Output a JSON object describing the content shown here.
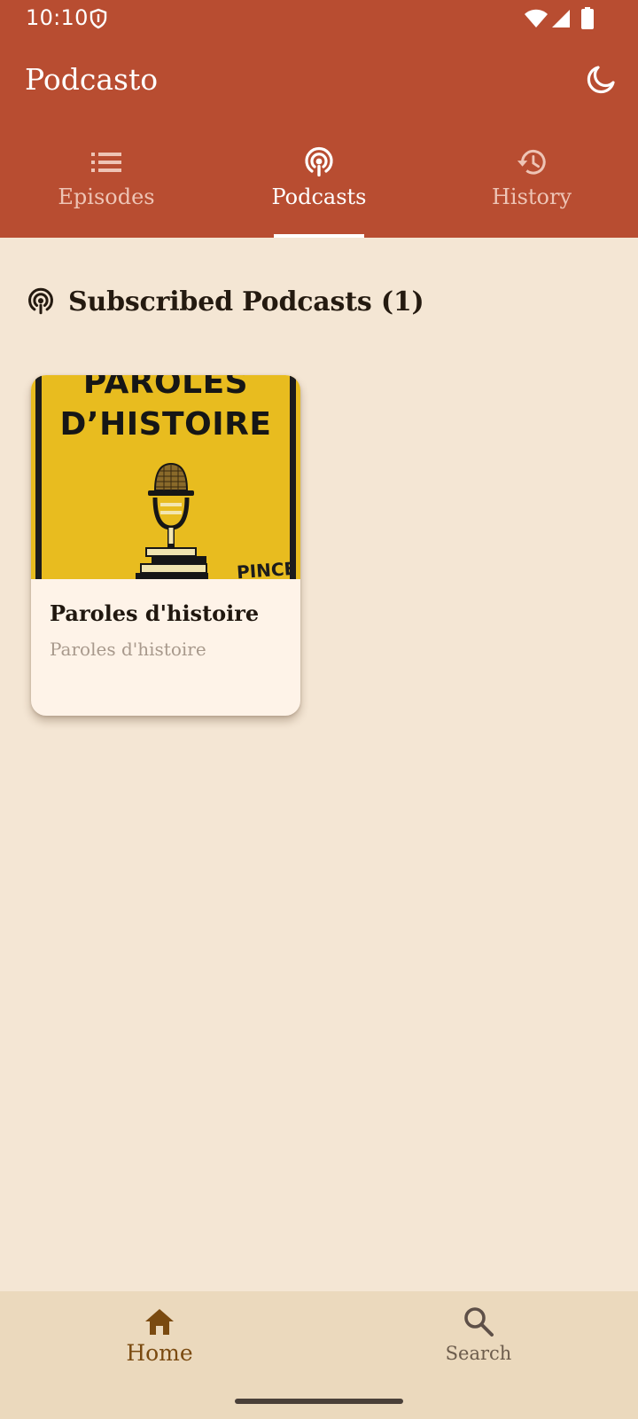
{
  "status_bar": {
    "time": "10:10",
    "icons": [
      "shield-icon",
      "wifi-icon",
      "signal-icon",
      "battery-icon"
    ]
  },
  "app_bar": {
    "title": "Podcasto",
    "theme_toggle_icon": "moon-icon"
  },
  "tabs": [
    {
      "label": "Episodes",
      "icon": "list-icon",
      "active": false
    },
    {
      "label": "Podcasts",
      "icon": "podcast-icon",
      "active": true
    },
    {
      "label": "History",
      "icon": "history-icon",
      "active": false
    }
  ],
  "section": {
    "title": "Subscribed Podcasts (1)",
    "icon": "podcast-icon"
  },
  "podcasts": [
    {
      "title": "Paroles d'histoire",
      "author": "Paroles d'histoire",
      "cover": {
        "line1": "PAROLES",
        "line2": "D’HISTOIRE",
        "signature": "PINCE"
      }
    }
  ],
  "bottom_nav": [
    {
      "label": "Home",
      "icon": "home-icon",
      "active": true
    },
    {
      "label": "Search",
      "icon": "search-icon",
      "active": false
    }
  ],
  "colors": {
    "primary": "#b84d31",
    "background": "#f4e6d4",
    "card": "#fef3e8",
    "bottom_nav": "#ebd9bd",
    "home_active": "#7a4a10",
    "cover_yellow": "#e8bc1f"
  }
}
